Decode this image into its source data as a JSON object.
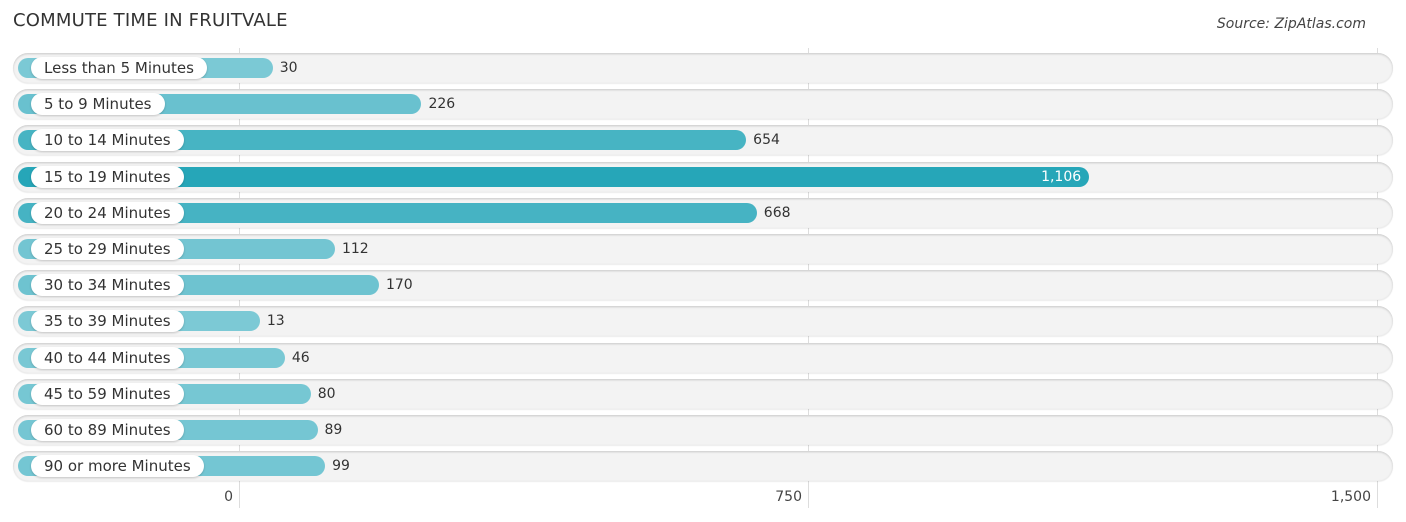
{
  "header": {
    "title": "COMMUTE TIME IN FRUITVALE",
    "source": "Source: ZipAtlas.com"
  },
  "chart_data": {
    "type": "bar",
    "orientation": "horizontal",
    "title": "COMMUTE TIME IN FRUITVALE",
    "xlabel": "",
    "ylabel": "",
    "xlim": [
      0,
      1500
    ],
    "x_ticks": [
      "0",
      "750",
      "1,500"
    ],
    "grid": true,
    "categories": [
      "Less than 5 Minutes",
      "5 to 9 Minutes",
      "10 to 14 Minutes",
      "15 to 19 Minutes",
      "20 to 24 Minutes",
      "25 to 29 Minutes",
      "30 to 34 Minutes",
      "35 to 39 Minutes",
      "40 to 44 Minutes",
      "45 to 59 Minutes",
      "60 to 89 Minutes",
      "90 or more Minutes"
    ],
    "values": [
      30,
      226,
      654,
      1106,
      668,
      112,
      170,
      13,
      46,
      80,
      89,
      99
    ],
    "value_labels": [
      "30",
      "226",
      "654",
      "1,106",
      "668",
      "112",
      "170",
      "13",
      "46",
      "80",
      "89",
      "99"
    ],
    "colors": {
      "low": "#7ecad6",
      "high": "#26a6b8",
      "track": "#f3f3f3"
    }
  }
}
